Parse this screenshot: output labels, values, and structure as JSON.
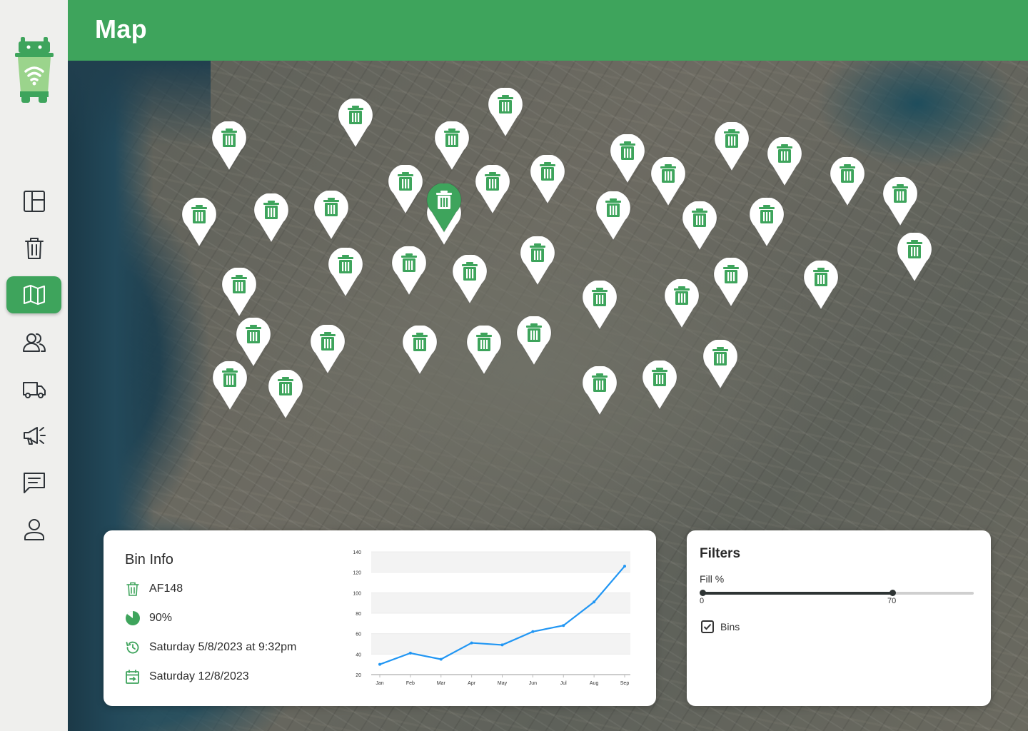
{
  "header": {
    "title": "Map"
  },
  "sidebar": {
    "items": [
      {
        "icon": "dashboard-icon",
        "active": false
      },
      {
        "icon": "trash-icon",
        "active": false
      },
      {
        "icon": "map-icon",
        "active": true
      },
      {
        "icon": "users-icon",
        "active": false
      },
      {
        "icon": "truck-icon",
        "active": false
      },
      {
        "icon": "megaphone-icon",
        "active": false
      },
      {
        "icon": "message-icon",
        "active": false
      },
      {
        "icon": "user-icon",
        "active": false
      }
    ]
  },
  "map": {
    "bin_marker_count": 46,
    "selected_marker_color": "#3ea45c",
    "marker_color": "#ffffff"
  },
  "bin_info": {
    "title": "Bin Info",
    "bin_id": "AF148",
    "fill_level": "90%",
    "last_update": "Saturday 5/8/2023 at 9:32pm",
    "next_collection": "Saturday 12/8/2023"
  },
  "chart_data": {
    "type": "line",
    "categories": [
      "Jan",
      "Feb",
      "Mar",
      "Apr",
      "May",
      "Jun",
      "Jul",
      "Aug",
      "Sep"
    ],
    "values": [
      30,
      41,
      35,
      51,
      49,
      62,
      68,
      91,
      126
    ],
    "ylim": [
      20,
      140
    ],
    "yticks": [
      20,
      40,
      60,
      80,
      100,
      120,
      140
    ],
    "color": "#2196f3",
    "grid": true
  },
  "filters": {
    "title": "Filters",
    "fill_label": "Fill %",
    "range": [
      0,
      70
    ],
    "min_label": "0",
    "max_label": "70",
    "bins_label": "Bins",
    "bins_checked": true
  },
  "colors": {
    "brand": "#3ea45c",
    "icon": "#2e3338"
  }
}
